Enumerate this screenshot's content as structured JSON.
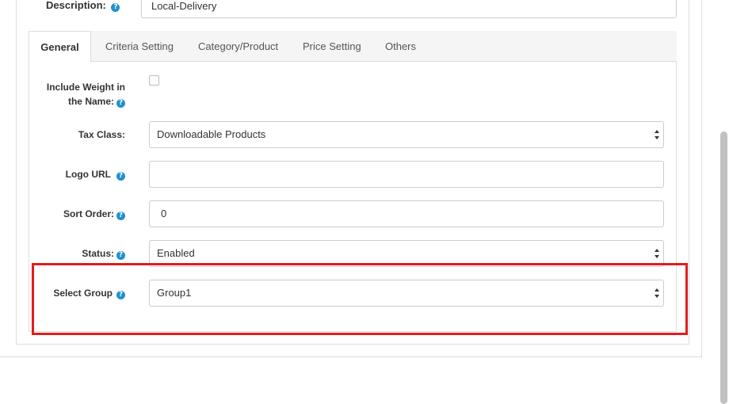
{
  "description": {
    "label": "Description:",
    "value": "Local-Delivery"
  },
  "tabs": [
    {
      "label": "General"
    },
    {
      "label": "Criteria Setting"
    },
    {
      "label": "Category/Product"
    },
    {
      "label": "Price Setting"
    },
    {
      "label": "Others"
    }
  ],
  "active_tab": "General",
  "form": {
    "include_weight": {
      "label_line1": "Include Weight in",
      "label_line2": "the Name:",
      "checked": false
    },
    "tax_class": {
      "label": "Tax Class:",
      "value": "Downloadable Products"
    },
    "logo_url": {
      "label": "Logo URL",
      "value": ""
    },
    "sort_order": {
      "label": "Sort Order:",
      "value": "0"
    },
    "status": {
      "label": "Status:",
      "value": "Enabled"
    },
    "select_group": {
      "label": "Select Group",
      "value": "Group1"
    }
  },
  "icons": {
    "help": "?"
  },
  "colors": {
    "help_icon": "#1e91cf",
    "highlight": "#e21d1d"
  }
}
